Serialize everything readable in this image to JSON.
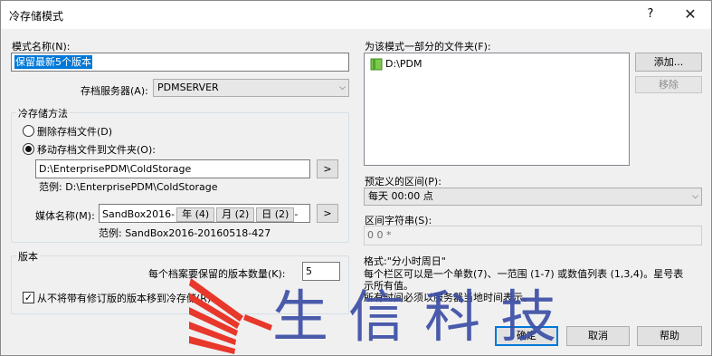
{
  "window": {
    "title": "冷存储模式",
    "help_label": "?",
    "close_label": "✕"
  },
  "left": {
    "scheme_name_label": "模式名称(N):",
    "scheme_name_value": "保留最新5个版本",
    "archive_server_label": "存档服务器(A):",
    "archive_server_value": "PDMSERVER",
    "method_group_title": "冷存储方法",
    "delete_option_label": "删除存档文件(D)",
    "move_option_label": "移动存档文件到文件夹(O):",
    "move_path_value": "D:\\EnterprisePDM\\ColdStorage",
    "browse_label": ">",
    "move_example": "范例: D:\\EnterprisePDM\\ColdStorage",
    "media_name_label": "媒体名称(M):",
    "media_name_prefix": "SandBox2016-",
    "media_tokens": [
      "年 (4)",
      "月 (2)",
      "日 (2)"
    ],
    "media_trailing": "-",
    "media_browse_label": ">",
    "media_example": "范例: SandBox2016-20160518-427",
    "version_group_title": "版本",
    "keep_count_label": "每个档案要保留的版本数量(K):",
    "keep_count_value": "5",
    "exclude_revised_label": "从不将带有修订版的版本移到冷存储(R)",
    "exclude_revised_checked": true
  },
  "right": {
    "folders_label": "为该模式一部分的文件夹(F):",
    "folders": [
      "D:\\PDM"
    ],
    "add_label": "添加...",
    "remove_label": "移除",
    "predefined_interval_label": "预定义的区间(P):",
    "predefined_interval_value": "每天 00:00 点",
    "interval_string_label": "区间字符串(S):",
    "interval_string_value": "0 0 *",
    "format_title": "格式:\"分小时周日\"",
    "format_desc1": "每个栏区可以是一个单数(7)、一范围 (1-7) 或数值列表 (1,3,4)。星号表",
    "format_desc2": "示所有值。",
    "format_desc3": "所有时间必须以服务器当地时间表示。"
  },
  "footer": {
    "ok_label": "确定",
    "cancel_label": "取消",
    "help_label": "帮助"
  },
  "watermark": {
    "text": "生信科技",
    "brand_color": "#e8372b",
    "text_color": "#3c4fa6"
  }
}
